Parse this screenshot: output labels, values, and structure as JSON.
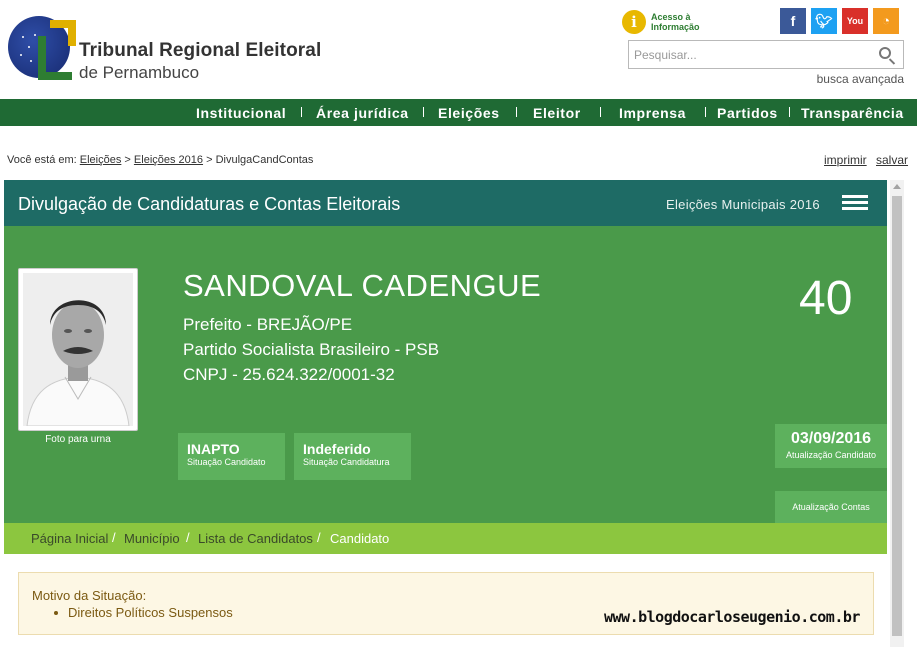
{
  "header": {
    "org_title": "Tribunal Regional Eleitoral",
    "org_subtitle": "de Pernambuco",
    "access_line1": "Acesso à",
    "access_line2": "Informação",
    "access_icon": "info-icon",
    "social": [
      {
        "name": "facebook-icon",
        "glyph": "f",
        "color": "#3b5998"
      },
      {
        "name": "twitter-icon",
        "glyph": "t",
        "color": "#1da1f2"
      },
      {
        "name": "youtube-icon",
        "glyph": "You",
        "color": "#d9302a"
      },
      {
        "name": "rss-icon",
        "glyph": "◔",
        "color": "#f39a1e"
      }
    ],
    "search_placeholder": "Pesquisar...",
    "advanced_search": "busca avançada"
  },
  "nav": {
    "items": [
      "Institucional",
      "Área jurídica",
      "Eleições",
      "Eleitor",
      "Imprensa",
      "Partidos",
      "Transparência"
    ],
    "background": "#1f6a34"
  },
  "breadcrumb": {
    "prefix": "Você está em:",
    "links": [
      "Eleições",
      "Eleições 2016"
    ],
    "current": "DivulgaCandContas",
    "sep": ">"
  },
  "utilities": {
    "print": "imprimir",
    "save": "salvar"
  },
  "panel": {
    "title": "Divulgação de Candidaturas e Contas Eleitorais",
    "subtitle": "Eleições Municipais 2016",
    "header_color": "#1e6b65",
    "body_color": "#4a9a4a"
  },
  "candidate": {
    "photo_label": "Foto para urna",
    "name": "SANDOVAL CADENGUE",
    "office": "Prefeito - BREJÃO/PE",
    "party": "Partido Socialista Brasileiro - PSB",
    "cnpj": "CNPJ - 25.624.322/0001-32",
    "number": "40",
    "status_candidate": {
      "value": "INAPTO",
      "label": "Situação Candidato"
    },
    "status_candidacy": {
      "value": "Indeferido",
      "label": "Situação Candidatura"
    },
    "update_candidate": {
      "value": "03/09/2016",
      "label": "Atualização Candidato"
    },
    "update_accounts": {
      "label": "Atualização Contas"
    }
  },
  "sub_breadcrumb": {
    "items": [
      "Página Inicial",
      "Município",
      "Lista de Candidatos"
    ],
    "current": "Candidato",
    "sep": "/"
  },
  "motive": {
    "title": "Motivo da Situação:",
    "items": [
      "Direitos Políticos Suspensos"
    ]
  },
  "watermark": "www.blogdocarloseugenio.com.br"
}
